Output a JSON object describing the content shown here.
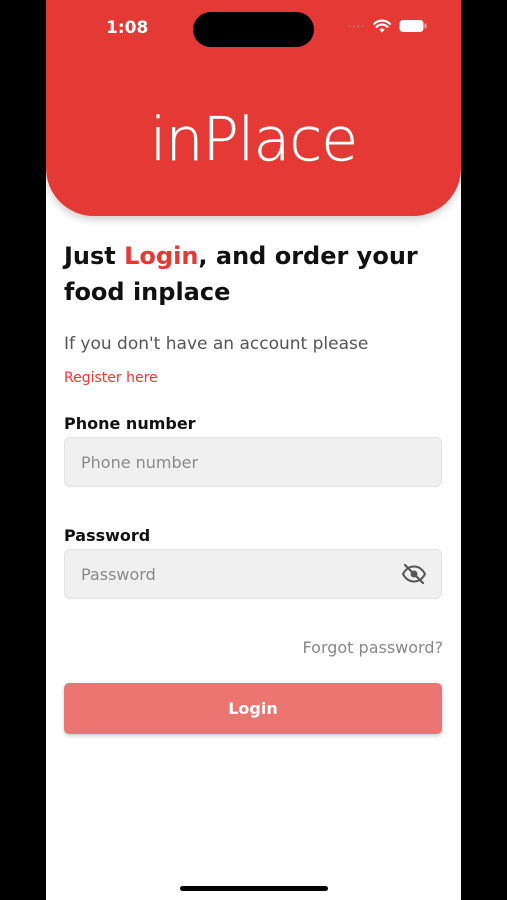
{
  "status_bar": {
    "time": "1:08",
    "signal_dots": "····"
  },
  "header": {
    "logo_text": "inPlace"
  },
  "headline": {
    "part1": "Just ",
    "accent": "Login",
    "part2": ", and order your food inplace"
  },
  "account_prompt": {
    "text": "If you don't have an account please",
    "register_link": "Register here"
  },
  "phone_field": {
    "label": "Phone number",
    "placeholder": "Phone number",
    "value": ""
  },
  "password_field": {
    "label": "Password",
    "placeholder": "Password",
    "value": "",
    "visibility_icon": "eye-off-icon"
  },
  "forgot_password": "Forgot password?",
  "login_button": "Login",
  "colors": {
    "brand_red": "#e53935",
    "button_red": "#ec7572",
    "field_bg": "#f0f0f0"
  }
}
